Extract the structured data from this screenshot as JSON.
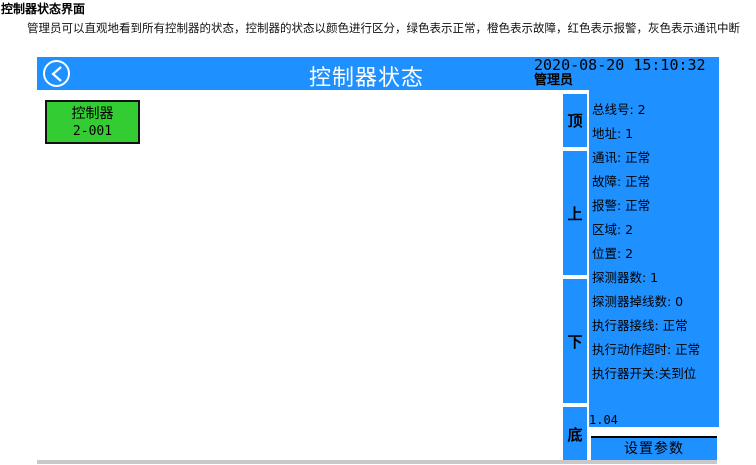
{
  "doc": {
    "heading": "控制器状态界面",
    "paragraph": "管理员可以直观地看到所有控制器的状态，控制器的状态以颜色进行区分，绿色表示正常，橙色表示故障，红色表示报警，灰色表示通讯中断"
  },
  "header": {
    "title": "控制器状态",
    "datetime": "2020-08-20 15:10:32",
    "user": "管理员",
    "back_icon": "back-arrow-icon"
  },
  "controllers": [
    {
      "name": "控制器",
      "addr": "2-001",
      "status_color": "#33cc33"
    }
  ],
  "nav": {
    "top": "顶",
    "up": "上",
    "down": "下",
    "bottom": "底"
  },
  "info": [
    "总线号: 2",
    "地址: 1",
    "通讯: 正常",
    "故障: 正常",
    "报警: 正常",
    "区域: 2",
    "位置: 2",
    "探测器数: 1",
    "探测器掉线数: 0",
    "执行器接线: 正常",
    "执行动作超时: 正常",
    "执行器开关:关到位"
  ],
  "version": "1.04",
  "settings_label": "设置参数",
  "colors": {
    "accent": "#1e90ff",
    "normal": "#33cc33",
    "fault": "orange",
    "alarm": "red",
    "offline": "gray"
  }
}
